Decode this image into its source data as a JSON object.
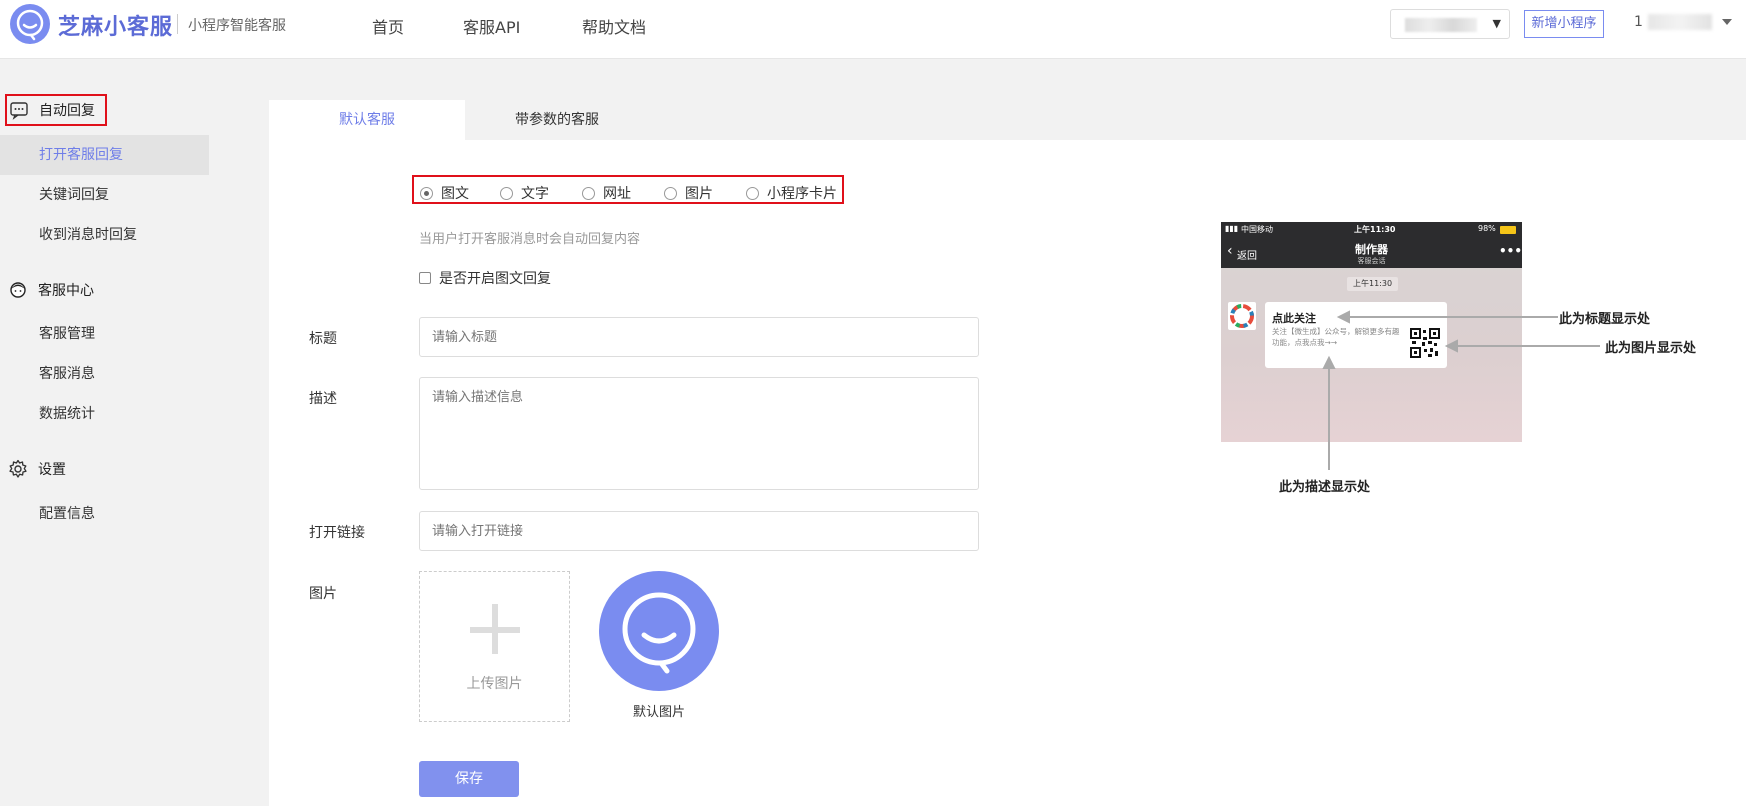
{
  "header": {
    "brand": "芝麻小客服",
    "subtitle": "小程序智能客服",
    "nav": [
      "首页",
      "客服API",
      "帮助文档"
    ],
    "new_app_button": "新增小程序",
    "user_prefix": "1"
  },
  "sidebar": {
    "sections": [
      {
        "title": "自动回复",
        "icon": "chat-bubble-icon",
        "items": [
          "打开客服回复",
          "关键词回复",
          "收到消息时回复"
        ]
      },
      {
        "title": "客服中心",
        "icon": "agent-avatar-icon",
        "items": [
          "客服管理",
          "客服消息",
          "数据统计"
        ]
      },
      {
        "title": "设置",
        "icon": "gear-icon",
        "items": [
          "配置信息"
        ]
      }
    ],
    "active_item": "打开客服回复"
  },
  "tabs": [
    "默认客服",
    "带参数的客服"
  ],
  "reply_types": [
    "图文",
    "文字",
    "网址",
    "图片",
    "小程序卡片"
  ],
  "selected_type": "图文",
  "hint": "当用户打开客服消息时会自动回复内容",
  "enable_checkbox": "是否开启图文回复",
  "form": {
    "title_label": "标题",
    "title_placeholder": "请输入标题",
    "desc_label": "描述",
    "desc_placeholder": "请输入描述信息",
    "link_label": "打开链接",
    "link_placeholder": "请输入打开链接",
    "image_label": "图片",
    "upload_label": "上传图片",
    "default_image_label": "默认图片",
    "save": "保存"
  },
  "preview": {
    "carrier": "中国移动",
    "status_time": "上午11:30",
    "battery": "98%",
    "back": "返回",
    "title": "制作器",
    "subtitle": "客服会话",
    "chat_time": "上午11:30",
    "card_title": "点此关注",
    "card_desc": "关注【微生成】公众号，解锁更多有趣功能，点我点我→→"
  },
  "annotations": {
    "title_hint": "此为标题显示处",
    "image_hint": "此为图片显示处",
    "desc_hint": "此为描述显示处"
  },
  "colors": {
    "accent": "#6f7ee8",
    "brand_blue": "#7a8cf0",
    "highlight_red": "#e0101a"
  }
}
